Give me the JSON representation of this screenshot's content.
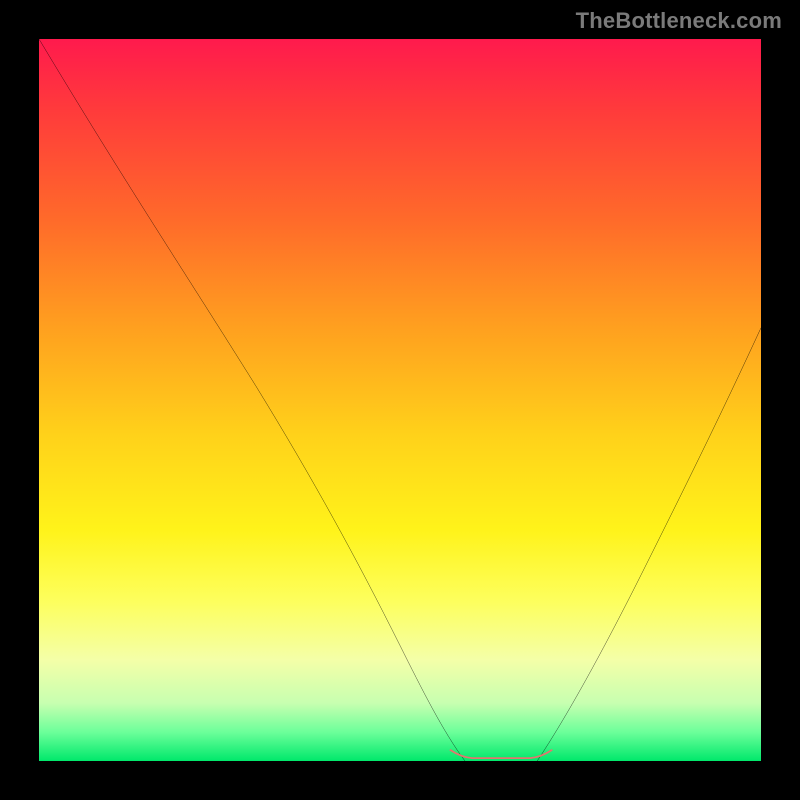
{
  "watermark": "TheBottleneck.com",
  "chart_data": {
    "type": "line",
    "title": "",
    "xlabel": "",
    "ylabel": "",
    "xlim": [
      0,
      100
    ],
    "ylim": [
      0,
      100
    ],
    "grid": false,
    "background_gradient": {
      "top": "#ff1a4d",
      "bottom": "#00e86b"
    },
    "series": [
      {
        "name": "left-curve",
        "color": "#000000",
        "x": [
          0,
          5,
          10,
          15,
          20,
          25,
          30,
          35,
          40,
          45,
          50,
          54,
          57,
          59
        ],
        "values": [
          100,
          92,
          84,
          76,
          67,
          58,
          49,
          40,
          31,
          22,
          13,
          6,
          2,
          0
        ]
      },
      {
        "name": "right-curve",
        "color": "#000000",
        "x": [
          69,
          72,
          75,
          78,
          82,
          86,
          90,
          94,
          97,
          100
        ],
        "values": [
          0,
          3,
          7,
          12,
          19,
          28,
          37,
          46,
          53,
          60
        ]
      },
      {
        "name": "flat-highlight",
        "color": "#e2766e",
        "x": [
          57,
          59,
          61,
          63,
          65,
          67,
          69,
          71
        ],
        "values": [
          1.5,
          0.6,
          0.3,
          0.3,
          0.3,
          0.3,
          0.6,
          1.5
        ]
      }
    ],
    "annotations": []
  }
}
